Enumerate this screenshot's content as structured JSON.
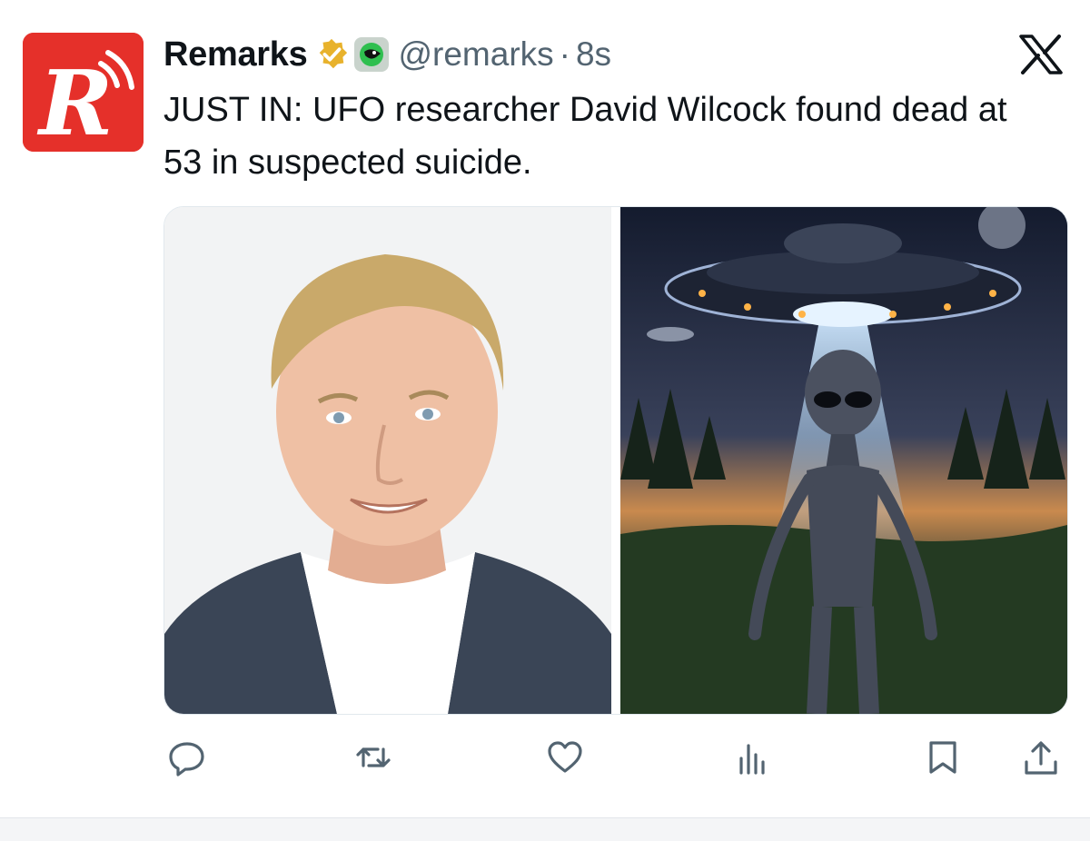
{
  "account": {
    "display_name": "Remarks",
    "handle": "@remarks",
    "separator": "·",
    "time": "8s",
    "avatar_icon": "remarks-r-logo",
    "avatar_color": "#e5302a",
    "verified_color": "#e8b22c"
  },
  "tweet": {
    "text": "JUST IN: UFO researcher David Wilcock found dead at 53 in suspected suicide."
  },
  "media": [
    {
      "kind": "photo",
      "subject": "portrait-photo"
    },
    {
      "kind": "photo",
      "subject": "alien-ufo-illustration"
    }
  ],
  "actions": [
    {
      "name": "reply",
      "icon": "reply-icon"
    },
    {
      "name": "repost",
      "icon": "repost-icon"
    },
    {
      "name": "like",
      "icon": "heart-icon"
    },
    {
      "name": "views",
      "icon": "views-chart-icon"
    },
    {
      "name": "bookmark",
      "icon": "bookmark-icon"
    },
    {
      "name": "share",
      "icon": "share-icon"
    }
  ],
  "colors": {
    "text": "#0f1419",
    "secondary": "#536471",
    "icon": "#536471"
  }
}
